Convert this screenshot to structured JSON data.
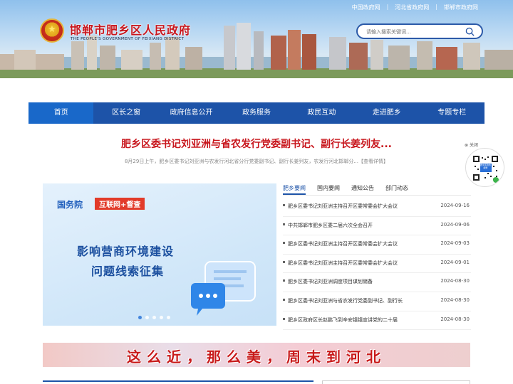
{
  "header": {
    "links": [
      "中国政府网",
      "河北省政府网",
      "邯郸市政府网"
    ],
    "title": "邯郸市肥乡区人民政府",
    "subtitle": "THE PEOPLE'S GOVERNMENT OF FEIXIANG DISTRICT",
    "search_placeholder": "请输入搜索关键词..."
  },
  "nav": {
    "items": [
      "首页",
      "区长之窗",
      "政府信息公开",
      "政务服务",
      "政民互动",
      "走进肥乡",
      "专题专栏"
    ],
    "active_index": 0
  },
  "headline": {
    "title": "肥乡区委书记刘亚洲与省农发行党委副书记、副行长姜列友...",
    "summary": "8月29日上午，肥乡区委书记刘亚洲与农发行河北省分行党委副书记、副行长姜列友，农发行河北邯郸分...【查看详情】"
  },
  "qr": {
    "close_label": "关闭",
    "badge": "肥乡区政务服务"
  },
  "slider": {
    "brand": "国务院",
    "tag": "互联网+督查",
    "line1": "影响营商环境建设",
    "line2": "问题线索征集",
    "dot_count": 5,
    "active_dot": 0
  },
  "news": {
    "tabs": [
      "肥乡要闻",
      "国内要闻",
      "通知公告",
      "部门动态"
    ],
    "active_tab": 0,
    "rows": [
      {
        "title": "肥乡区委书记刘亚洲主持召开区委常委会扩大会议",
        "date": "2024-09-16"
      },
      {
        "title": "中共邯郸市肥乡区委二届六次全会召开",
        "date": "2024-09-06"
      },
      {
        "title": "肥乡区委书记刘亚洲主持召开区委常委会扩大会议",
        "date": "2024-09-03"
      },
      {
        "title": "肥乡区委书记刘亚洲主持召开区委常委会扩大会议",
        "date": "2024-09-01"
      },
      {
        "title": "肥乡区委书记刘亚洲调度项目谋划储备",
        "date": "2024-08-30"
      },
      {
        "title": "肥乡区委书记刘亚洲与省农发行党委副书记、副行长",
        "date": "2024-08-30"
      },
      {
        "title": "肥乡区政府区长赵鹏飞到辛安镇镇宣讲党的二十届",
        "date": "2024-08-30"
      }
    ]
  },
  "banner": {
    "text": "这么近，那么美，周末到河北"
  },
  "colors": {
    "nav_bg": "#1d53a8",
    "nav_active": "#1968c9",
    "headline_red": "#c8161d"
  }
}
